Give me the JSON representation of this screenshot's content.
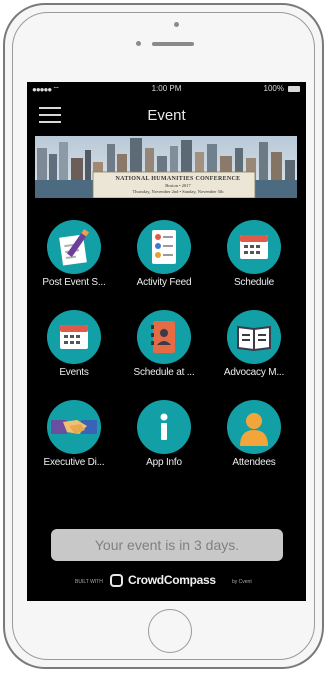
{
  "status_bar": {
    "signal": "●●●●● ⌔",
    "time": "1:00 PM",
    "battery_text": "100%"
  },
  "header": {
    "title": "Event"
  },
  "banner": {
    "title": "NATIONAL HUMANITIES CONFERENCE",
    "location": "Boston • 2017",
    "dates": "Thursday, November 2nd • Sunday, November 5th"
  },
  "tiles": [
    {
      "label": "Post Event S...",
      "icon": "pencil-paper-icon"
    },
    {
      "label": "Activity Feed",
      "icon": "activity-feed-icon"
    },
    {
      "label": "Schedule",
      "icon": "calendar-icon"
    },
    {
      "label": "Events",
      "icon": "calendar-icon"
    },
    {
      "label": "Schedule at ...",
      "icon": "address-book-icon"
    },
    {
      "label": "Advocacy M...",
      "icon": "open-book-icon"
    },
    {
      "label": "Executive Di...",
      "icon": "handshake-icon"
    },
    {
      "label": "App Info",
      "icon": "info-icon"
    },
    {
      "label": "Attendees",
      "icon": "person-icon"
    }
  ],
  "countdown": {
    "text": "Your event is in 3 days."
  },
  "footer": {
    "built_with": "BUILT WITH",
    "brand": "CrowdCompass",
    "by": "by Cvent"
  },
  "colors": {
    "accent": "#12a0a6",
    "screen_bg": "#000000",
    "countdown_bg": "#c8c8c8"
  }
}
